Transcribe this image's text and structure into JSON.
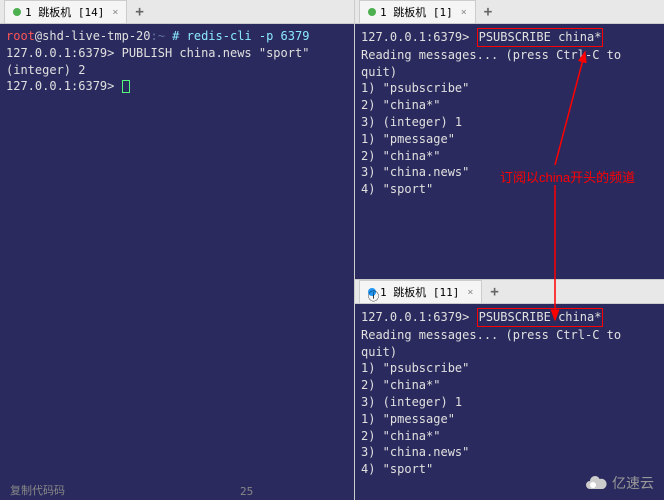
{
  "left": {
    "tab": {
      "label": "1 跳板机 [14]"
    },
    "lines": [
      {
        "parts": [
          {
            "text": "root",
            "cls": "red-text"
          },
          {
            "text": "@shd-live-tmp-20",
            "cls": ""
          },
          {
            "text": ":~",
            "cls": "blue-text"
          },
          {
            "text": " # redis-cli -p 6379",
            "cls": "cyan-text"
          }
        ]
      },
      {
        "parts": [
          {
            "text": "127.0.0.1:6379> PUBLISH china.news \"sport\"",
            "cls": ""
          }
        ]
      },
      {
        "parts": [
          {
            "text": "(integer) 2",
            "cls": ""
          }
        ]
      },
      {
        "parts": [
          {
            "text": "127.0.0.1:6379> ",
            "cls": ""
          }
        ],
        "cursor": true
      }
    ]
  },
  "rightTop": {
    "tab": {
      "label": "1 跳板机 [1]"
    },
    "prompt": "127.0.0.1:6379> ",
    "command": "PSUBSCRIBE china*",
    "lines": [
      "Reading messages... (press Ctrl-C to quit)",
      "1) \"psubscribe\"",
      "2) \"china*\"",
      "3) (integer) 1",
      "1) \"pmessage\"",
      "2) \"china*\"",
      "3) \"china.news\"",
      "4) \"sport\""
    ]
  },
  "rightBottom": {
    "tab": {
      "label": "1 跳板机 [11]"
    },
    "prompt": "127.0.0.1:6379> ",
    "command": "PSUBSCRIBE china*",
    "lines": [
      "Reading messages... (press Ctrl-C to quit)",
      "1) \"psubscribe\"",
      "2) \"china*\"",
      "3) (integer) 1",
      "1) \"pmessage\"",
      "2) \"china*\"",
      "3) \"china.news\"",
      "4) \"sport\""
    ]
  },
  "annotation": "订阅以china开头的频道",
  "watermark": "亿速云",
  "footer": "复制代码码",
  "footerNum": "25"
}
